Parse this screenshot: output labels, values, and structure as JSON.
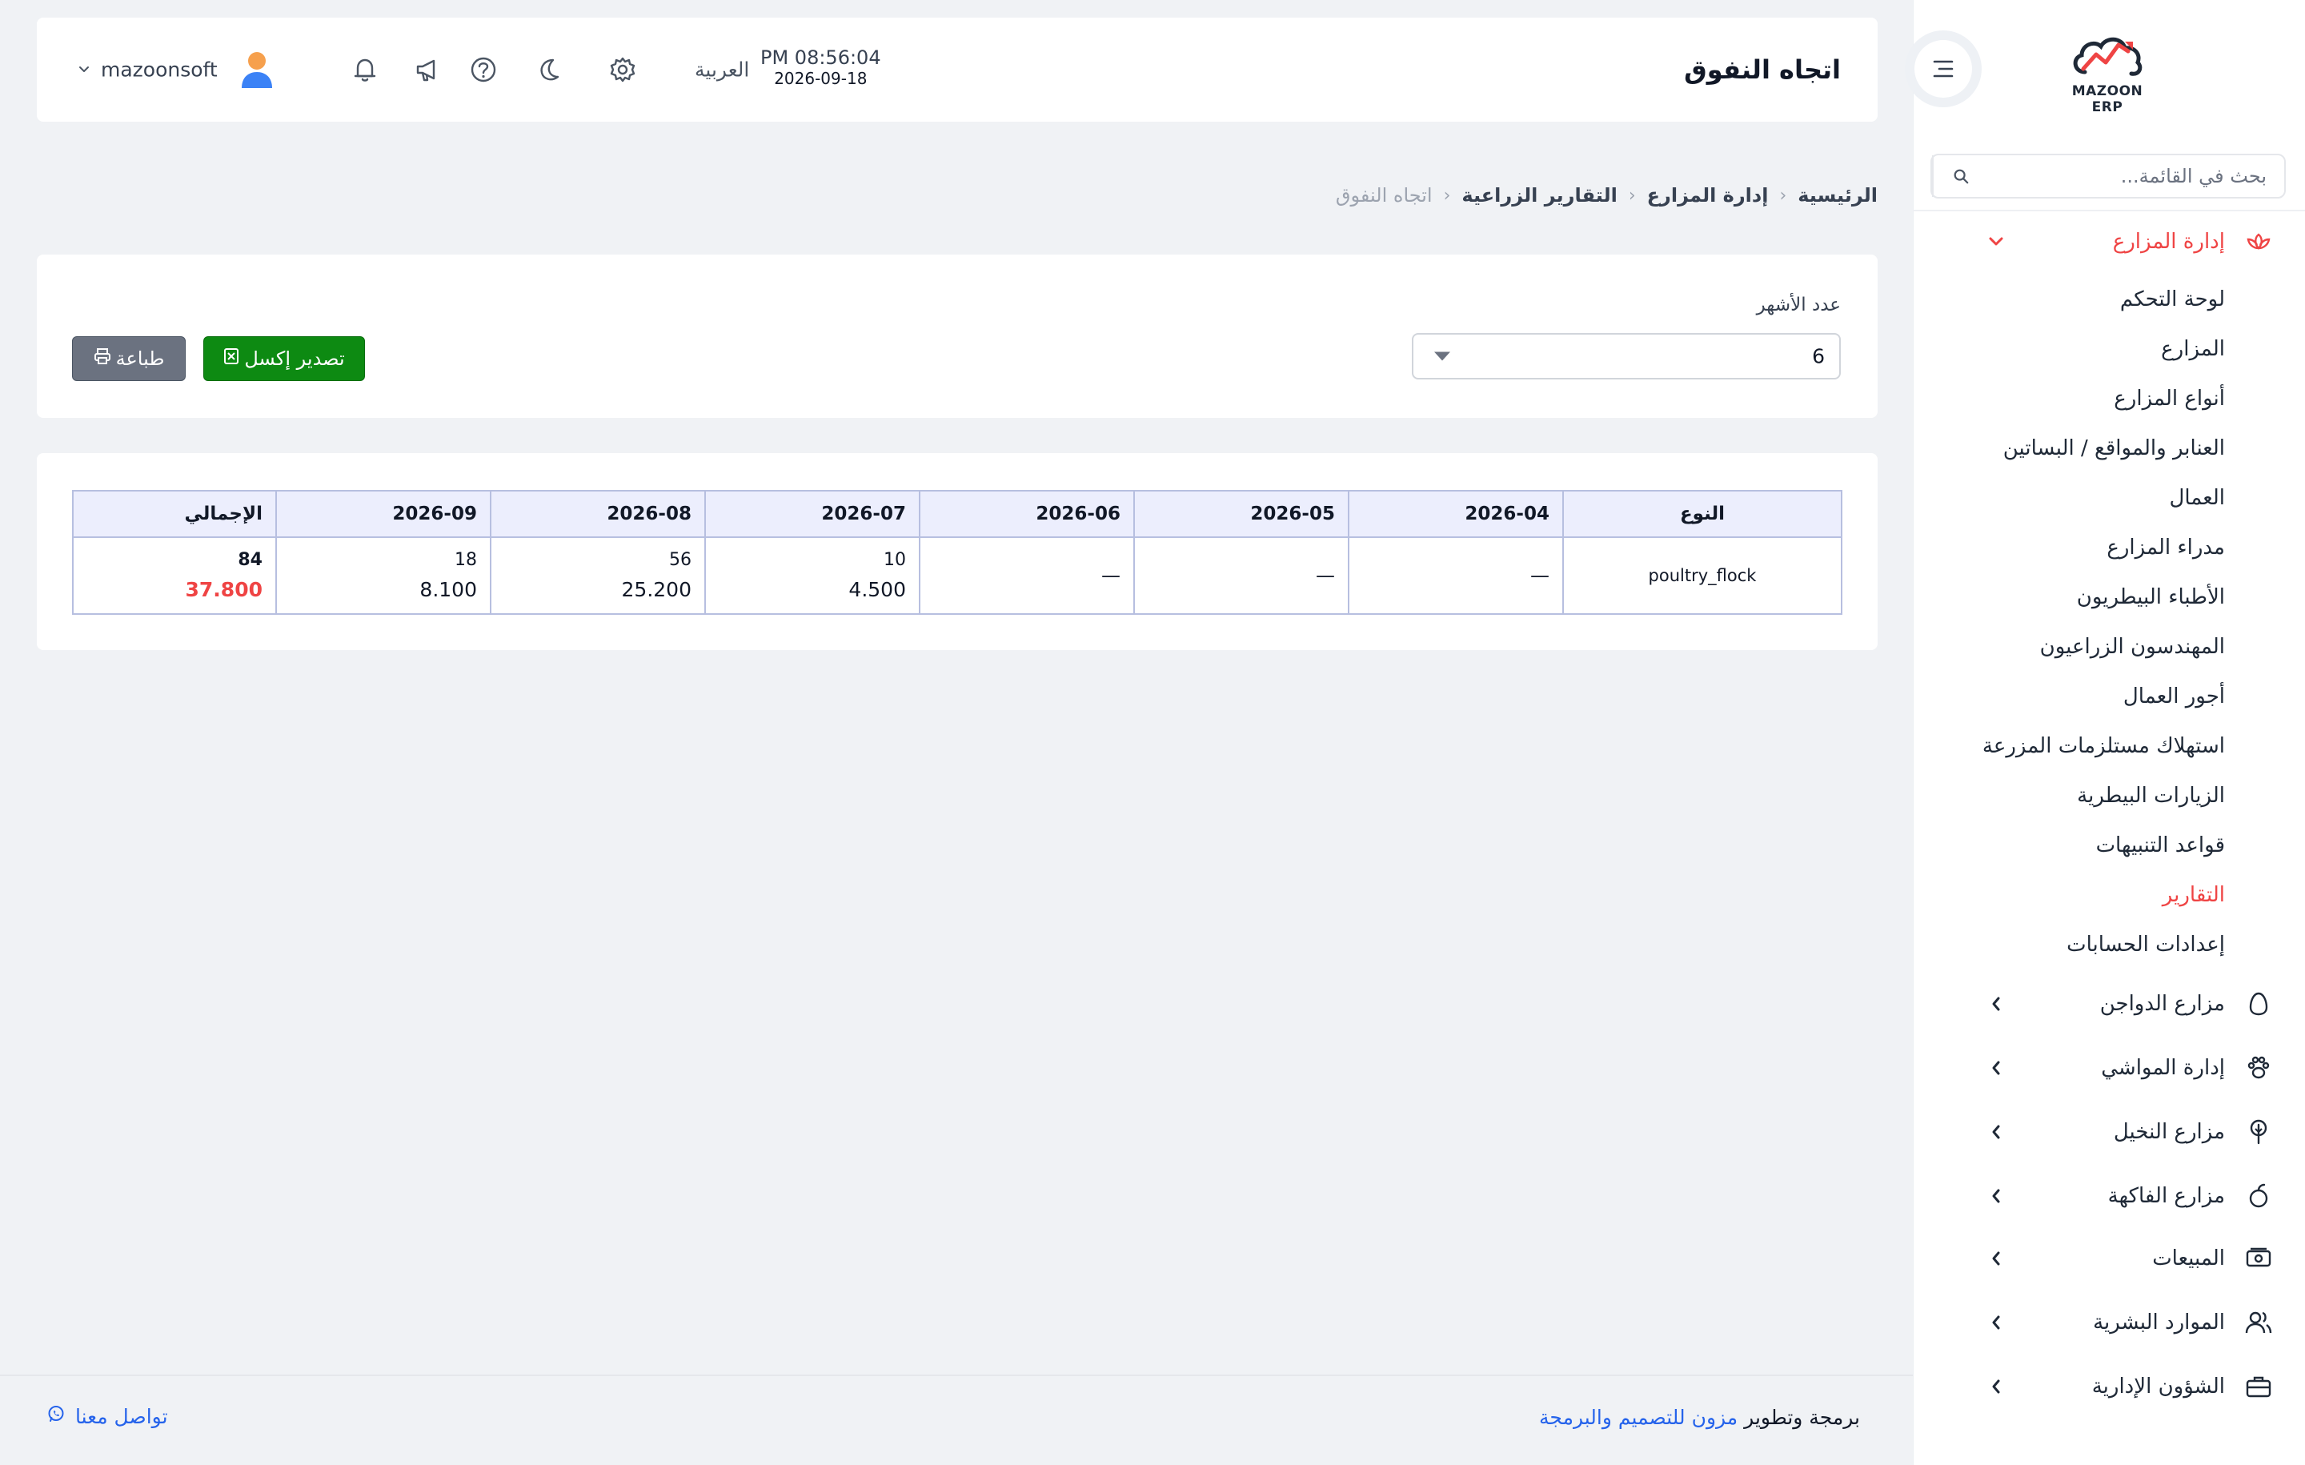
{
  "brand": {
    "logo_text": "MAZOON ERP",
    "logo_badge": "ERP",
    "accent_color": "#ef4444",
    "link_color": "#2563eb"
  },
  "sidebar": {
    "search_placeholder": "بحث في القائمة...",
    "active_group": {
      "label": "إدارة المزارع",
      "icon": "lotus-icon",
      "items": [
        {
          "label": "لوحة التحكم",
          "active": false
        },
        {
          "label": "المزارع",
          "active": false
        },
        {
          "label": "أنواع المزارع",
          "active": false
        },
        {
          "label": "العنابر والمواقع / البساتين",
          "active": false
        },
        {
          "label": "العمال",
          "active": false
        },
        {
          "label": "مدراء المزارع",
          "active": false
        },
        {
          "label": "الأطباء البيطريون",
          "active": false
        },
        {
          "label": "المهندسون الزراعيون",
          "active": false
        },
        {
          "label": "أجور العمال",
          "active": false
        },
        {
          "label": "استهلاك مستلزمات المزرعة",
          "active": false
        },
        {
          "label": "الزيارات البيطرية",
          "active": false
        },
        {
          "label": "قواعد التنبيهات",
          "active": false
        },
        {
          "label": "التقارير",
          "active": true
        },
        {
          "label": "إعدادات الحسابات",
          "active": false
        }
      ]
    },
    "groups": [
      {
        "label": "مزارع الدواجن",
        "icon": "egg-icon"
      },
      {
        "label": "إدارة المواشي",
        "icon": "paw-icon"
      },
      {
        "label": "مزارع النخيل",
        "icon": "palm-tree-icon"
      },
      {
        "label": "مزارع الفاكهة",
        "icon": "apple-icon"
      },
      {
        "label": "المبيعات",
        "icon": "cash-icon"
      },
      {
        "label": "الموارد البشرية",
        "icon": "users-icon"
      },
      {
        "label": "الشؤون الإدارية",
        "icon": "briefcase-icon"
      }
    ]
  },
  "header": {
    "title": "اتجاه النفوق",
    "time": "PM 08:56:04",
    "date": "2026-09-18",
    "language": "العربية",
    "username": "mazoonsoft",
    "icons": [
      "settings-icon",
      "moon-icon",
      "help-icon",
      "megaphone-icon",
      "bell-icon",
      "user-avatar-icon"
    ]
  },
  "breadcrumb": [
    "الرئيسية",
    "إدارة المزارع",
    "التقارير الزراعية",
    "اتجاه النفوق"
  ],
  "filters": {
    "months_label": "عدد الأشهر",
    "months_value": "6",
    "export_excel_label": "تصدير إكسل",
    "print_label": "طباعة"
  },
  "table": {
    "headers": {
      "type": "النوع",
      "months": [
        "2026-04",
        "2026-05",
        "2026-06",
        "2026-07",
        "2026-08",
        "2026-09"
      ],
      "total": "الإجمالي"
    },
    "rows": [
      {
        "type": "poultry_flock",
        "cells": [
          {
            "qty": "—",
            "amount": ""
          },
          {
            "qty": "—",
            "amount": ""
          },
          {
            "qty": "—",
            "amount": ""
          },
          {
            "qty": "10",
            "amount": "4.500"
          },
          {
            "qty": "56",
            "amount": "25.200"
          },
          {
            "qty": "18",
            "amount": "8.100"
          }
        ],
        "total": {
          "qty": "84",
          "amount": "37.800"
        }
      }
    ]
  },
  "footer": {
    "credit_prefix": "برمجة وتطوير",
    "credit_link": "مزون للتصميم والبرمجة",
    "contact": "تواصل معنا"
  }
}
